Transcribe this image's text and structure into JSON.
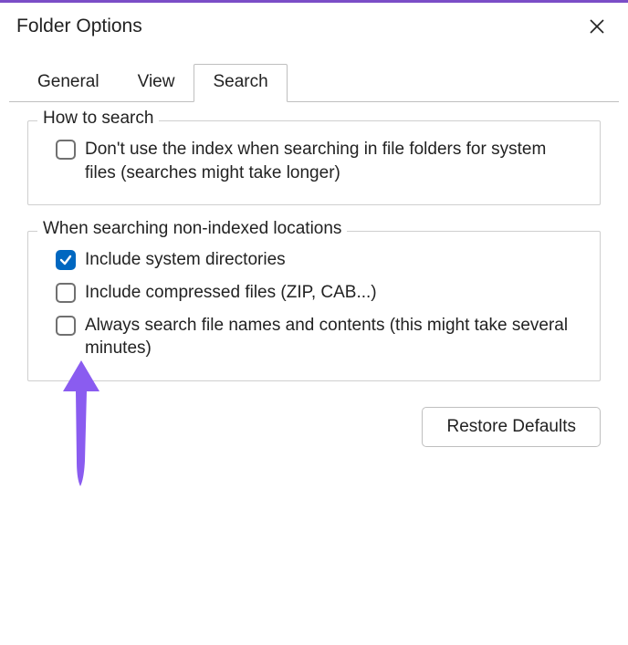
{
  "window": {
    "title": "Folder Options"
  },
  "tabs": {
    "general": "General",
    "view": "View",
    "search": "Search",
    "active": "search"
  },
  "section1": {
    "legend": "How to search",
    "opt_no_index": "Don't use the index when searching in file folders for system files (searches might take longer)"
  },
  "section2": {
    "legend": "When searching non-indexed locations",
    "opt_system_dirs": "Include system directories",
    "opt_compressed": "Include compressed files (ZIP, CAB...)",
    "opt_always_search": "Always search file names and contents (this might take several minutes)"
  },
  "buttons": {
    "restore_defaults": "Restore Defaults"
  },
  "checks": {
    "no_index": false,
    "system_dirs": true,
    "compressed": false,
    "always_search": false
  }
}
